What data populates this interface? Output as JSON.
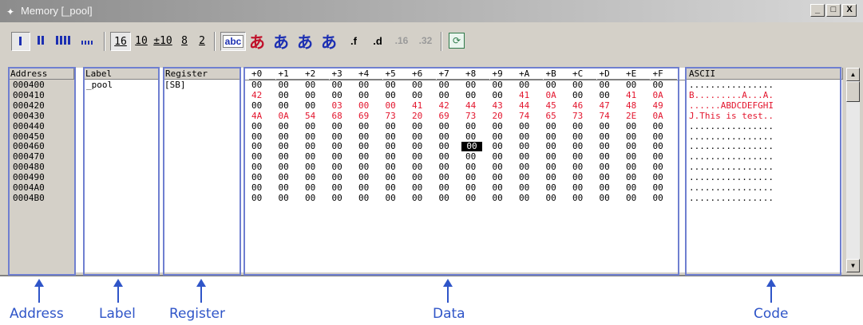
{
  "window": {
    "title": "Memory [_pool]",
    "controls": [
      "_",
      "□",
      "X"
    ]
  },
  "toolbar": {
    "radix_16": "16",
    "radix_10": "10",
    "radix_signed10": "±10",
    "radix_8": "8",
    "radix_2": "2",
    "abc_label": "abc",
    "kana_1": "あ",
    "kana_2": "あ",
    "kana_3": "あ",
    "kana_4": "あ",
    "float_f": ".f",
    "float_d": ".d",
    "fmt_16": ".16",
    "fmt_32": ".32"
  },
  "grid": {
    "headers": {
      "address": "Address",
      "label": "Label",
      "register": "Register",
      "offsets": [
        "+0",
        "+1",
        "+2",
        "+3",
        "+4",
        "+5",
        "+6",
        "+7",
        "+8",
        "+9",
        "+A",
        "+B",
        "+C",
        "+D",
        "+E",
        "+F"
      ],
      "ascii": "ASCII"
    },
    "rows": [
      {
        "address": "000400",
        "label": "_pool",
        "register": "[SB]",
        "bytes": [
          "00",
          "00",
          "00",
          "00",
          "00",
          "00",
          "00",
          "00",
          "00",
          "00",
          "00",
          "00",
          "00",
          "00",
          "00",
          "00"
        ],
        "ascii": "................"
      },
      {
        "address": "000410",
        "label": "",
        "register": "",
        "bytes": [
          "42",
          "00",
          "00",
          "00",
          "00",
          "00",
          "00",
          "00",
          "00",
          "00",
          "41",
          "0A",
          "00",
          "00",
          "41",
          "0A"
        ],
        "ascii": "B.........A...A."
      },
      {
        "address": "000420",
        "label": "",
        "register": "",
        "bytes": [
          "00",
          "00",
          "00",
          "03",
          "00",
          "00",
          "41",
          "42",
          "44",
          "43",
          "44",
          "45",
          "46",
          "47",
          "48",
          "49"
        ],
        "ascii": "......ABDCDEFGHI"
      },
      {
        "address": "000430",
        "label": "",
        "register": "",
        "bytes": [
          "4A",
          "0A",
          "54",
          "68",
          "69",
          "73",
          "20",
          "69",
          "73",
          "20",
          "74",
          "65",
          "73",
          "74",
          "2E",
          "0A"
        ],
        "ascii": "J.This is test.."
      },
      {
        "address": "000440",
        "label": "",
        "register": "",
        "bytes": [
          "00",
          "00",
          "00",
          "00",
          "00",
          "00",
          "00",
          "00",
          "00",
          "00",
          "00",
          "00",
          "00",
          "00",
          "00",
          "00"
        ],
        "ascii": "................"
      },
      {
        "address": "000450",
        "label": "",
        "register": "",
        "bytes": [
          "00",
          "00",
          "00",
          "00",
          "00",
          "00",
          "00",
          "00",
          "00",
          "00",
          "00",
          "00",
          "00",
          "00",
          "00",
          "00"
        ],
        "ascii": "................"
      },
      {
        "address": "000460",
        "label": "",
        "register": "",
        "bytes": [
          "00",
          "00",
          "00",
          "00",
          "00",
          "00",
          "00",
          "00",
          "00",
          "00",
          "00",
          "00",
          "00",
          "00",
          "00",
          "00"
        ],
        "ascii": "................"
      },
      {
        "address": "000470",
        "label": "",
        "register": "",
        "bytes": [
          "00",
          "00",
          "00",
          "00",
          "00",
          "00",
          "00",
          "00",
          "00",
          "00",
          "00",
          "00",
          "00",
          "00",
          "00",
          "00"
        ],
        "ascii": "................"
      },
      {
        "address": "000480",
        "label": "",
        "register": "",
        "bytes": [
          "00",
          "00",
          "00",
          "00",
          "00",
          "00",
          "00",
          "00",
          "00",
          "00",
          "00",
          "00",
          "00",
          "00",
          "00",
          "00"
        ],
        "ascii": "................"
      },
      {
        "address": "000490",
        "label": "",
        "register": "",
        "bytes": [
          "00",
          "00",
          "00",
          "00",
          "00",
          "00",
          "00",
          "00",
          "00",
          "00",
          "00",
          "00",
          "00",
          "00",
          "00",
          "00"
        ],
        "ascii": "................"
      },
      {
        "address": "0004A0",
        "label": "",
        "register": "",
        "bytes": [
          "00",
          "00",
          "00",
          "00",
          "00",
          "00",
          "00",
          "00",
          "00",
          "00",
          "00",
          "00",
          "00",
          "00",
          "00",
          "00"
        ],
        "ascii": "................"
      },
      {
        "address": "0004B0",
        "label": "",
        "register": "",
        "bytes": [
          "00",
          "00",
          "00",
          "00",
          "00",
          "00",
          "00",
          "00",
          "00",
          "00",
          "00",
          "00",
          "00",
          "00",
          "00",
          "00"
        ],
        "ascii": "................"
      }
    ],
    "red_rows": [
      1,
      2,
      3
    ],
    "red_cells_row2_from": 3,
    "red_cells_row1": [
      0,
      10,
      11,
      14,
      15
    ],
    "selected": {
      "row": 6,
      "col": 8
    }
  },
  "annotations": {
    "address": "Address",
    "label": "Label",
    "register": "Register",
    "data": "Data",
    "code": "Code"
  },
  "colors": {
    "changed_value": "#e3162e",
    "annotation": "#2f55c8",
    "region_outline": "#6f7fd0"
  }
}
